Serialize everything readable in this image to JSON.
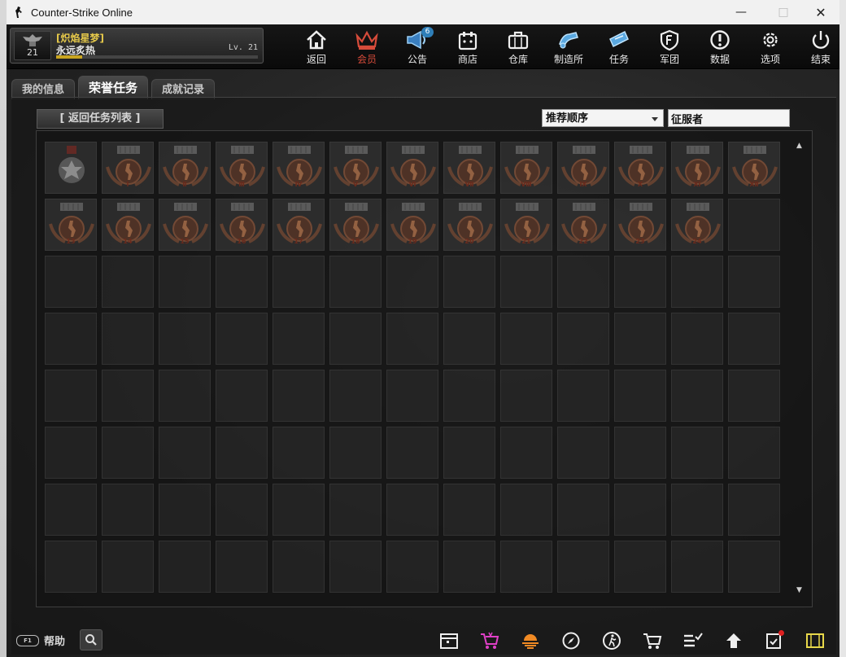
{
  "window": {
    "title": "Counter-Strike Online",
    "minimize": "—",
    "maximize": "□",
    "close": "✕"
  },
  "profile": {
    "rank_number": "21",
    "clan": "[炽焰星梦]",
    "nickname": "永远炙热",
    "level": "Lv. 21",
    "xp_fraction": 0.13
  },
  "nav": [
    {
      "label": "返回",
      "icon": "home-icon"
    },
    {
      "label": "会员",
      "icon": "crown-icon"
    },
    {
      "label": "公告",
      "icon": "megaphone-icon",
      "badge": "6"
    },
    {
      "label": "商店",
      "icon": "shop-icon"
    },
    {
      "label": "仓库",
      "icon": "briefcase-icon"
    },
    {
      "label": "制造所",
      "icon": "gear-arm-icon"
    },
    {
      "label": "任务",
      "icon": "ticket-icon"
    },
    {
      "label": "军团",
      "icon": "shield-icon"
    },
    {
      "label": "数据",
      "icon": "exclamation-icon"
    },
    {
      "label": "选项",
      "icon": "settings-icon"
    },
    {
      "label": "结束",
      "icon": "power-icon"
    }
  ],
  "tabs": [
    "我的信息",
    "荣誉任务",
    "成就记录"
  ],
  "active_tab": 1,
  "toolbar": {
    "back_label": "[ 返回任务列表 ]",
    "sort_value": "推荐顺序",
    "search_value": "征服者"
  },
  "grid": {
    "columns": 13,
    "rows": 8,
    "medals": [
      {
        "type": "silver"
      },
      {
        "type": "bronze",
        "rank": "Ⅰ"
      },
      {
        "type": "bronze",
        "rank": "Ⅱ"
      },
      {
        "type": "bronze",
        "rank": "Ⅲ"
      },
      {
        "type": "bronze",
        "rank": "Ⅳ"
      },
      {
        "type": "bronze",
        "rank": "Ⅴ"
      },
      {
        "type": "bronze",
        "rank": "Ⅵ"
      },
      {
        "type": "bronze",
        "rank": "Ⅶ"
      },
      {
        "type": "bronze",
        "rank": "Ⅷ"
      },
      {
        "type": "bronze",
        "rank": "Ⅸ"
      },
      {
        "type": "bronze",
        "rank": "Ⅹ"
      },
      {
        "type": "bronze",
        "rank": "Ⅺ"
      },
      {
        "type": "bronze",
        "rank": "Ⅻ"
      },
      {
        "type": "bronze",
        "rank": "13"
      },
      {
        "type": "bronze",
        "rank": "14"
      },
      {
        "type": "bronze",
        "rank": "15"
      },
      {
        "type": "bronze",
        "rank": "16"
      },
      {
        "type": "bronze",
        "rank": "17"
      },
      {
        "type": "bronze",
        "rank": "18"
      },
      {
        "type": "bronze",
        "rank": "19"
      },
      {
        "type": "bronze",
        "rank": "20"
      },
      {
        "type": "bronze",
        "rank": "21"
      },
      {
        "type": "bronze",
        "rank": "22"
      },
      {
        "type": "bronze",
        "rank": "23"
      },
      {
        "type": "bronze",
        "rank": "24"
      }
    ]
  },
  "bottom": {
    "help_label": "帮助",
    "help_key": "F1",
    "icons": [
      "calendar-icon",
      "vip-cart-icon",
      "sunset-icon",
      "compass-icon",
      "runner-icon",
      "cart-icon",
      "checklist-icon",
      "up-home-icon",
      "clipboard-icon",
      "film-icon"
    ]
  },
  "colors": {
    "accent_gold": "#e5c84a",
    "nav_active_red": "#d64b3a",
    "badge_blue": "#2f7fb8",
    "alert_red": "#e02020"
  }
}
